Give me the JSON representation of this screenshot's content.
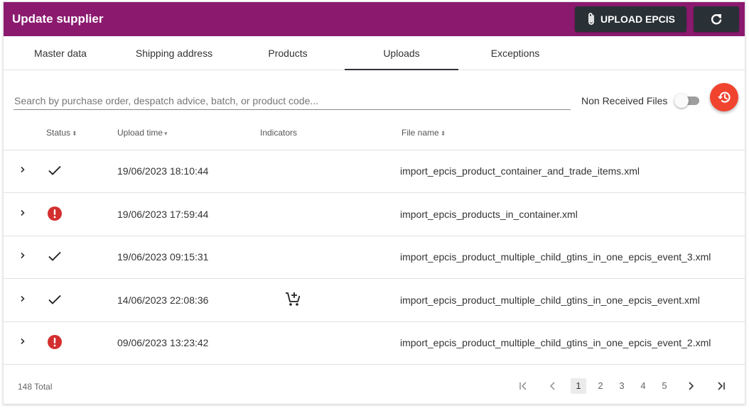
{
  "header": {
    "title": "Update supplier",
    "upload_label": "UPLOAD EPCIS"
  },
  "tabs": [
    {
      "label": "Master data"
    },
    {
      "label": "Shipping address"
    },
    {
      "label": "Products"
    },
    {
      "label": "Uploads",
      "active": true
    },
    {
      "label": "Exceptions"
    }
  ],
  "search": {
    "placeholder": "Search by purchase order, despatch advice, batch, or product code...",
    "value": ""
  },
  "filter": {
    "toggle_label": "Non Received Files",
    "toggle_on": false
  },
  "table": {
    "columns": {
      "status": "Status",
      "upload_time": "Upload time",
      "indicators": "Indicators",
      "file_name": "File name"
    },
    "rows": [
      {
        "status": "check-icon",
        "time": "19/06/2023 18:10:44",
        "indicator": "",
        "file": "import_epcis_product_container_and_trade_items.xml"
      },
      {
        "status": "error-icon",
        "time": "19/06/2023 17:59:44",
        "indicator": "",
        "file": "import_epcis_products_in_container.xml"
      },
      {
        "status": "check-icon",
        "time": "19/06/2023 09:15:31",
        "indicator": "",
        "file": "import_epcis_product_multiple_child_gtins_in_one_epcis_event_3.xml"
      },
      {
        "status": "check-icon",
        "time": "14/06/2023 22:08:36",
        "indicator": "add-shopping-cart-icon",
        "file": "import_epcis_product_multiple_child_gtins_in_one_epcis_event.xml"
      },
      {
        "status": "error-icon",
        "time": "09/06/2023 13:23:42",
        "indicator": "",
        "file": "import_epcis_product_multiple_child_gtins_in_one_epcis_event_2.xml"
      }
    ]
  },
  "footer": {
    "total": "148 Total",
    "pages": [
      "1",
      "2",
      "3",
      "4",
      "5"
    ],
    "current_page": "1"
  },
  "colors": {
    "header": "#8b1a6f",
    "dark_button": "#2a3136",
    "fab": "#f0442f",
    "error": "#d32f2f"
  }
}
